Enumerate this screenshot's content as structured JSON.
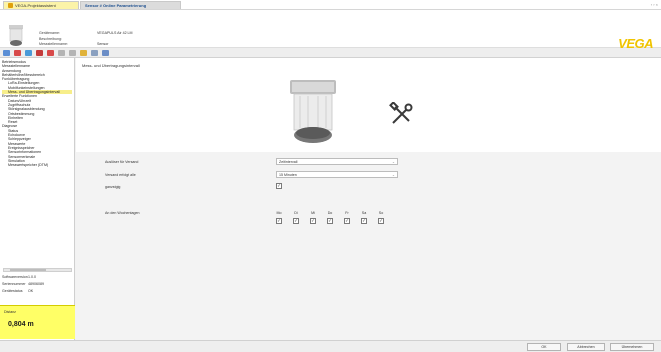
{
  "tabs": [
    {
      "label": "VEGA-Projektassistent"
    },
    {
      "label": "Sensor # Online Parametrierung"
    }
  ],
  "window_controls": "‹ › ×",
  "header": {
    "labels": [
      "Gerätename:",
      "Beschreibung:",
      "Messstellenname:"
    ],
    "values": [
      "VEGAPULS Air 42 LM",
      "",
      "Sensor"
    ],
    "logo": "VEGA"
  },
  "tree": [
    "Betriebsmodus",
    "Messstellenname",
    "Anwendung",
    "Behälterhöhe/Messbereich",
    "Funkübertragung",
    "LoRa-Einstellungen",
    "Mobilfunkeinstellungen",
    "Mess- und Übertragungsintervall",
    "Erweiterte Funktionen",
    "Datum/Uhrzeit",
    "Zugriffsschutz",
    "Störsignalausblendung",
    "Ortsbestimmung",
    "Einheiten",
    "Reset",
    "Diagnose",
    "Status",
    "Echokurve",
    "Schleppzeiger",
    "Messwerte",
    "Ereignisspeicher",
    "Sensorinformationen",
    "Sensormerkmale",
    "Simulation",
    "Messwertspeicher (DTM)"
  ],
  "info": [
    {
      "k": "Softwareversion",
      "v": "1.0.0"
    },
    {
      "k": "Seriennummer",
      "v": "48906089"
    },
    {
      "k": "Gerätestatus",
      "v": "OK"
    }
  ],
  "distance": {
    "label": "Distanz",
    "value": "0,804 m"
  },
  "main": {
    "title": "Mess- und Übertragungsintervall",
    "form": {
      "trigger_label": "Auslöser für Versand",
      "trigger_value": "Zeitintervall",
      "interval_label": "Versand erfolgt alle",
      "interval_value": "15 Minuten",
      "hourly_label": "ganzstgig",
      "weekdays_label": "An den Wochentagen",
      "days": [
        "Mo",
        "Di",
        "Mi",
        "Do",
        "Fr",
        "Sa",
        "So"
      ],
      "checkmark": "✓"
    }
  },
  "footer": {
    "ok": "OK",
    "cancel": "Abbrechen",
    "apply": "Übernehmen"
  }
}
